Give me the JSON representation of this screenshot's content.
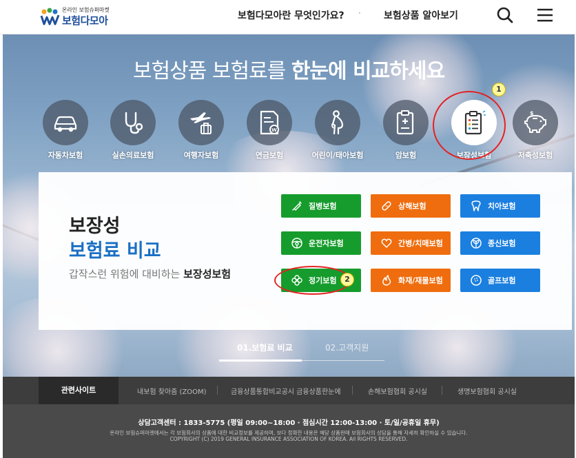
{
  "header": {
    "logo_small": "온라인 보험슈퍼마켓",
    "logo_big": "보험다모아",
    "nav": [
      "보험다모아란 무엇인가요?",
      "보험상품 알아보기"
    ],
    "nav_separator": "·",
    "search_icon": "search-icon",
    "menu_icon": "hamburger-menu-icon"
  },
  "hero": {
    "title_prefix": "보험상품 보험료를 ",
    "title_bold": "한눈에 비교하세요",
    "categories": [
      {
        "label": "자동차보험",
        "icon": "car-icon"
      },
      {
        "label": "실손의료보험",
        "icon": "stethoscope-icon"
      },
      {
        "label": "여행자보험",
        "icon": "plane-luggage-icon"
      },
      {
        "label": "연금보험",
        "icon": "pension-document-icon"
      },
      {
        "label": "어린이/태아보험",
        "icon": "pregnant-icon"
      },
      {
        "label": "암보험",
        "icon": "medical-chart-icon"
      },
      {
        "label": "보장성보험",
        "icon": "clipboard-icon",
        "active": true
      },
      {
        "label": "저축성보험",
        "icon": "piggy-bank-icon"
      }
    ]
  },
  "panel": {
    "title_line1": "보장성",
    "title_line2": "보험료 비교",
    "desc_prefix": "갑작스런 위험에 대비하는 ",
    "desc_bold": "보장성보험",
    "buttons": [
      {
        "label": "질병보험",
        "icon": "syringe-icon",
        "color": "#169c2c"
      },
      {
        "label": "상해보험",
        "icon": "bandage-icon",
        "color": "#ef6d0e"
      },
      {
        "label": "치아보험",
        "icon": "tooth-icon",
        "color": "#1b7fe0"
      },
      {
        "label": "운전자보험",
        "icon": "steering-wheel-icon",
        "color": "#169c2c"
      },
      {
        "label": "간병/치매보험",
        "icon": "heart-icon",
        "color": "#ef6d0e"
      },
      {
        "label": "종신보험",
        "icon": "sprout-icon",
        "color": "#1b7fe0"
      },
      {
        "label": "정기보험",
        "icon": "clover-icon",
        "color": "#169c2c"
      },
      {
        "label": "화재/재물보험",
        "icon": "flame-icon",
        "color": "#ef6d0e"
      },
      {
        "label": "골프보험",
        "icon": "golf-ball-icon",
        "color": "#1b7fe0"
      }
    ]
  },
  "callouts": [
    "1",
    "2"
  ],
  "tabs": [
    {
      "label": "01.보험료 비교",
      "active": true
    },
    {
      "label": "02.고객지원",
      "active": false
    }
  ],
  "footer": {
    "related_label": "관련사이트",
    "links": [
      "내보험 찾아줌 (ZOOM)",
      "금융상품통합비교공시 금융상품한눈에",
      "손해보험협회 공시실",
      "생명보험협회 공시실"
    ],
    "contact": "상담고객센터 : 1833-5775 (평일 09:00~18:00 · 점심시간 12:00-13:00 · 토/일/공휴일 휴무)",
    "notice": "온라인 보험슈퍼마켓에서는 각 보험회사의 상품에 대한 비교정보를 제공하며, 보다 정확한 내용은 해당 상품판매 보험회사의 상담을 통해 자세히 확인하실 수 있습니다.",
    "copyright": "COPYRIGHT (C) 2019 GENERAL INSURANCE ASSOCIATION OF KOREA. All RIGHTS RESERVED."
  },
  "colors": {
    "green": "#169c2c",
    "orange": "#ef6d0e",
    "blue": "#1b7fe0",
    "title_blue": "#1a6fc4",
    "callout_red": "#e32222"
  }
}
